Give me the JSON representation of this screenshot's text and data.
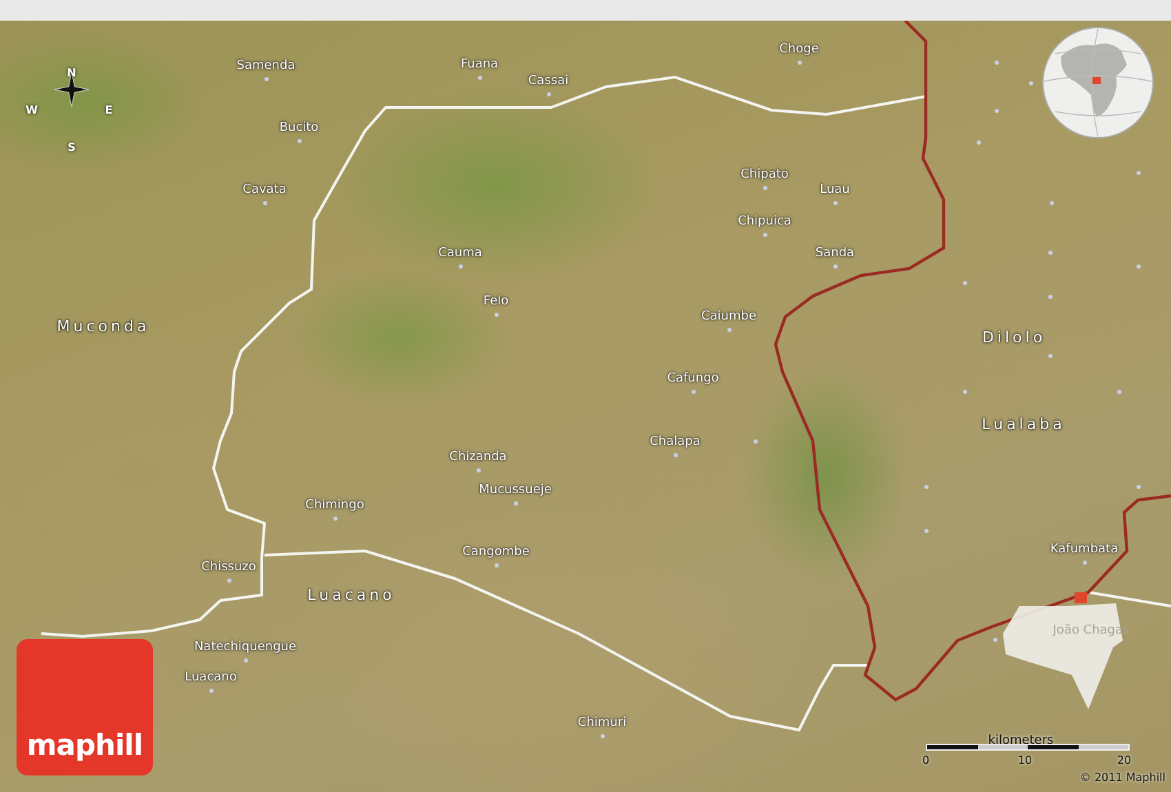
{
  "compass": {
    "north": "N",
    "east": "E",
    "south": "S",
    "west": "W"
  },
  "places": [
    {
      "name": "Samenda"
    },
    {
      "name": "Fuana"
    },
    {
      "name": "Cassai"
    },
    {
      "name": "Bucito"
    },
    {
      "name": "Cavata"
    },
    {
      "name": "Cauma"
    },
    {
      "name": "Felo"
    },
    {
      "name": "Choge"
    },
    {
      "name": "Chipato"
    },
    {
      "name": "Luau"
    },
    {
      "name": "Chipuica"
    },
    {
      "name": "Sanda"
    },
    {
      "name": "Caiumbe"
    },
    {
      "name": "Cafungo"
    },
    {
      "name": "Chalapa"
    },
    {
      "name": "Chizanda"
    },
    {
      "name": "Mucussueje"
    },
    {
      "name": "Chimingo"
    },
    {
      "name": "Cangombe"
    },
    {
      "name": "Chissuzo"
    },
    {
      "name": "Natechiquengue"
    },
    {
      "name": "Luacano"
    },
    {
      "name": "Chimuri"
    },
    {
      "name": "Kafumbata"
    },
    {
      "name": "João Chagas"
    }
  ],
  "regions": [
    {
      "name": "Muconda"
    },
    {
      "name": "Luacano"
    },
    {
      "name": "Dilolo"
    },
    {
      "name": "Lualaba"
    }
  ],
  "logo": "maphill",
  "scale": {
    "unit": "kilometers",
    "ticks": [
      "0",
      "10",
      "20"
    ]
  },
  "copyright": "© 2011 Maphill"
}
